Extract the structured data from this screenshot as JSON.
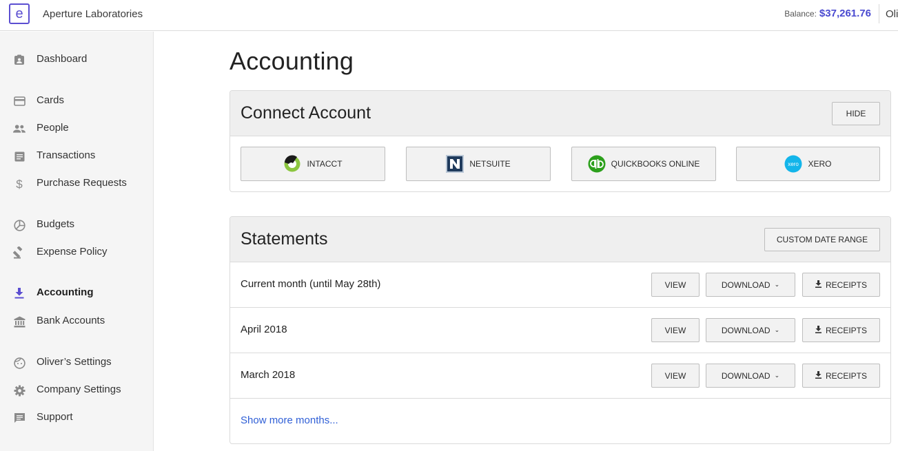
{
  "header": {
    "logo_letter": "e",
    "company": "Aperture Laboratories",
    "balance_label": "Balance:",
    "balance_value": "$37,261.76",
    "user_name": "Oli"
  },
  "sidebar": {
    "items": [
      {
        "label": "Dashboard",
        "icon": "dashboard-icon"
      },
      {
        "label": "Cards",
        "icon": "card-icon"
      },
      {
        "label": "People",
        "icon": "people-icon"
      },
      {
        "label": "Transactions",
        "icon": "transactions-icon"
      },
      {
        "label": "Purchase Requests",
        "icon": "dollar-icon"
      },
      {
        "label": "Budgets",
        "icon": "pie-icon"
      },
      {
        "label": "Expense Policy",
        "icon": "gavel-icon"
      },
      {
        "label": "Accounting",
        "icon": "download-icon",
        "active": true
      },
      {
        "label": "Bank Accounts",
        "icon": "bank-icon"
      },
      {
        "label": "Oliver’s Settings",
        "icon": "face-icon"
      },
      {
        "label": "Company Settings",
        "icon": "gear-icon"
      },
      {
        "label": "Support",
        "icon": "chat-icon"
      }
    ]
  },
  "main": {
    "title": "Accounting",
    "connect": {
      "title": "Connect Account",
      "hide_label": "HIDE",
      "integrations": [
        {
          "label": "INTACCT",
          "icon": "intacct-logo-icon"
        },
        {
          "label": "NETSUITE",
          "icon": "netsuite-logo-icon"
        },
        {
          "label": "QUICKBOOKS ONLINE",
          "icon": "quickbooks-logo-icon"
        },
        {
          "label": "XERO",
          "icon": "xero-logo-icon",
          "logo_text": "xero"
        }
      ]
    },
    "statements": {
      "title": "Statements",
      "custom_range_label": "CUSTOM DATE RANGE",
      "rows": [
        {
          "label": "Current month (until May 28th)",
          "view": "VIEW",
          "download": "DOWNLOAD",
          "receipts": "RECEIPTS"
        },
        {
          "label": "April 2018",
          "view": "VIEW",
          "download": "DOWNLOAD",
          "receipts": "RECEIPTS"
        },
        {
          "label": "March 2018",
          "view": "VIEW",
          "download": "DOWNLOAD",
          "receipts": "RECEIPTS"
        }
      ],
      "show_more": "Show more months..."
    }
  },
  "colors": {
    "accent": "#5b4ed1",
    "balance": "#4a4ad0",
    "link": "#2f5fd6",
    "quickbooks": "#2ca01c",
    "xero": "#13b5ea",
    "intacct_green": "#8cc63f"
  }
}
